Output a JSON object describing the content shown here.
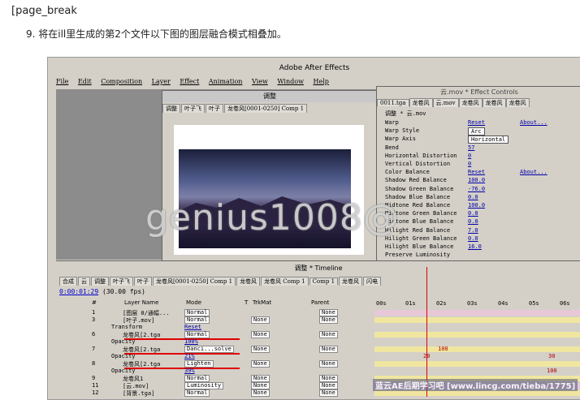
{
  "doc": {
    "break_text": "[page_break",
    "step_text": "9. 将在ill里生成的第2个文件以下图的图层融合模式相叠加。"
  },
  "app": {
    "title": "Adobe After Effects",
    "menu": [
      "File",
      "Edit",
      "Composition",
      "Layer",
      "Effect",
      "Animation",
      "View",
      "Window",
      "Help"
    ]
  },
  "comp_window": {
    "title": "调整",
    "tabs": [
      "调整",
      "叶子飞",
      "叶子",
      "龙卷风[0001-0250] Comp 1"
    ]
  },
  "effect_controls": {
    "title": "云.mov * Effect Controls",
    "tabs": [
      "0011.tga",
      "龙卷风",
      "云.mov",
      "龙卷风",
      "龙卷风",
      "龙卷风"
    ],
    "layer_label": "调整 * 云.mov",
    "rows": [
      {
        "name": "Warp",
        "value": "Reset",
        "about": "About..."
      },
      {
        "name": "Warp Style",
        "value": "Arc",
        "about": ""
      },
      {
        "name": "Warp Axis",
        "value": "Horizontal",
        "about": ""
      },
      {
        "name": "Bend",
        "value": "57",
        "about": ""
      },
      {
        "name": "Horizontal Distortion",
        "value": "0",
        "about": ""
      },
      {
        "name": "Vertical Distortion",
        "value": "0",
        "about": ""
      },
      {
        "name": "Color Balance",
        "value": "Reset",
        "about": "About..."
      },
      {
        "name": "Shadow Red Balance",
        "value": "100.0",
        "about": ""
      },
      {
        "name": "Shadow Green Balance",
        "value": "-76.0",
        "about": ""
      },
      {
        "name": "Shadow Blue Balance",
        "value": "0.0",
        "about": ""
      },
      {
        "name": "Midtone Red Balance",
        "value": "100.0",
        "about": ""
      },
      {
        "name": "Midtone Green Balance",
        "value": "0.0",
        "about": ""
      },
      {
        "name": "Midtone Blue Balance",
        "value": "0.0",
        "about": ""
      },
      {
        "name": "Hilight Red Balance",
        "value": "7.0",
        "about": ""
      },
      {
        "name": "Hilight Green Balance",
        "value": "0.0",
        "about": ""
      },
      {
        "name": "Hilight Blue Balance",
        "value": "16.0",
        "about": ""
      },
      {
        "name": "Preserve Luminosity",
        "value": "",
        "about": ""
      }
    ]
  },
  "watermark": {
    "main": "genius1008@",
    "small": "蓝云AE后期学习吧 [www.lincg.com/tieba/1775]"
  },
  "timeline": {
    "title": "调整 * Timeline",
    "tabs": [
      "合成",
      "云",
      "调整",
      "叶子飞",
      "叶子",
      "龙卷风[0001-0250] Comp 1",
      "龙卷风",
      "龙卷风 Comp 1",
      "Comp 1",
      "龙卷风",
      "闪电"
    ],
    "time": "0:00:01:29",
    "fps": "(30.00 fps)",
    "headers": {
      "num": "#",
      "layer": "Layer Name",
      "mode": "Mode",
      "t": "T",
      "trkmat": "TrkMat",
      "parent": "Parent"
    },
    "ruler": [
      "00s",
      "01s",
      "02s",
      "03s",
      "04s",
      "05s",
      "06s"
    ],
    "rows": [
      {
        "num": "1",
        "name": "[图层 0/通幅...",
        "mode": "Normal",
        "trk": "",
        "parent": "None"
      },
      {
        "num": "3",
        "name": "[叶子.mov]",
        "mode": "Normal",
        "trk": "None",
        "parent": "None"
      },
      {
        "num": "",
        "name": "Transform",
        "mode": "Reset",
        "trk": "",
        "parent": ""
      },
      {
        "num": "6",
        "name": "龙卷风[2.tga",
        "mode": "Normal",
        "trk": "None",
        "parent": "None"
      },
      {
        "num": "",
        "name": "Opacity",
        "mode": "100%",
        "trk": "",
        "parent": ""
      },
      {
        "num": "7",
        "name": "龙卷风[2.tga",
        "mode": "Danci...solve",
        "trk": "None",
        "parent": "None"
      },
      {
        "num": "",
        "name": "Opacity",
        "mode": "21%",
        "trk": "",
        "parent": ""
      },
      {
        "num": "8",
        "name": "龙卷风[2.tga",
        "mode": "Lighten",
        "trk": "None",
        "parent": "None"
      },
      {
        "num": "",
        "name": "Opacity",
        "mode": "39%",
        "trk": "",
        "parent": ""
      },
      {
        "num": "9",
        "name": "龙卷风1",
        "mode": "Normal",
        "trk": "None",
        "parent": "None"
      },
      {
        "num": "11",
        "name": "[云.mov]",
        "mode": "Luminosity",
        "trk": "None",
        "parent": "None"
      },
      {
        "num": "12",
        "name": "[背景.tga]",
        "mode": "Normal",
        "trk": "None",
        "parent": "None"
      }
    ],
    "keys": {
      "k100": "100",
      "k20": "20",
      "k30": "30",
      "k100b": "100"
    }
  }
}
